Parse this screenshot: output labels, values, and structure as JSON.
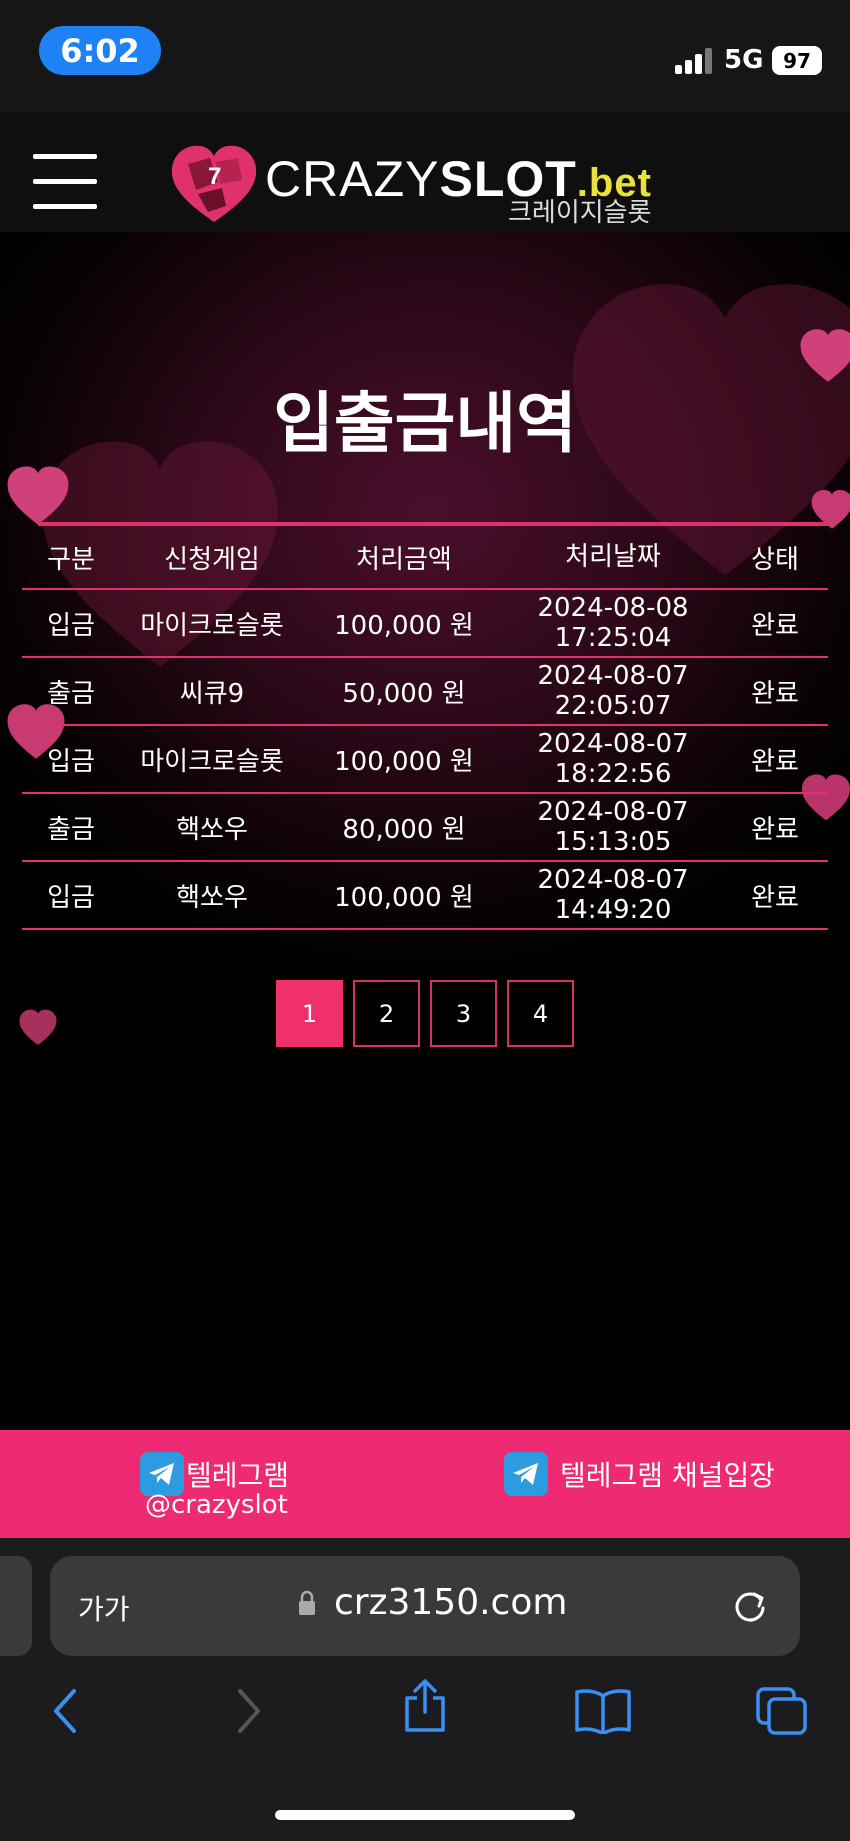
{
  "status_bar": {
    "time": "6:02",
    "network": "5G",
    "battery": "97"
  },
  "header": {
    "logo_part1": "CRAZY",
    "logo_part2": "SLOT",
    "logo_part3": ".bet",
    "logo_subtitle": "크레이지슬롯"
  },
  "page": {
    "title": "입출금내역"
  },
  "table": {
    "headers": [
      "구분",
      "신청게임",
      "처리금액",
      "처리날짜",
      "상태"
    ],
    "rows": [
      {
        "type": "입금",
        "game": "마이크로슬롯",
        "amount": "100,000 원",
        "date": "2024-08-08",
        "time": "17:25:04",
        "status": "완료"
      },
      {
        "type": "출금",
        "game": "씨큐9",
        "amount": "50,000 원",
        "date": "2024-08-07",
        "time": "22:05:07",
        "status": "완료"
      },
      {
        "type": "입금",
        "game": "마이크로슬롯",
        "amount": "100,000 원",
        "date": "2024-08-07",
        "time": "18:22:56",
        "status": "완료"
      },
      {
        "type": "출금",
        "game": "핵쏘우",
        "amount": "80,000 원",
        "date": "2024-08-07",
        "time": "15:13:05",
        "status": "완료"
      },
      {
        "type": "입금",
        "game": "핵쏘우",
        "amount": "100,000 원",
        "date": "2024-08-07",
        "time": "14:49:20",
        "status": "완료"
      }
    ]
  },
  "pagination": {
    "pages": [
      "1",
      "2",
      "3",
      "4"
    ],
    "active": "1"
  },
  "footer": {
    "telegram_label": "텔레그램",
    "telegram_handle": "@crazyslot",
    "telegram_channel": "텔레그램 채널입장"
  },
  "browser": {
    "text_size_label": "가가",
    "url": "crz3150.com"
  },
  "colors": {
    "accent": "#ee2a73",
    "logo_bet": "#e8e23b",
    "link_blue": "#3a8ff0"
  }
}
